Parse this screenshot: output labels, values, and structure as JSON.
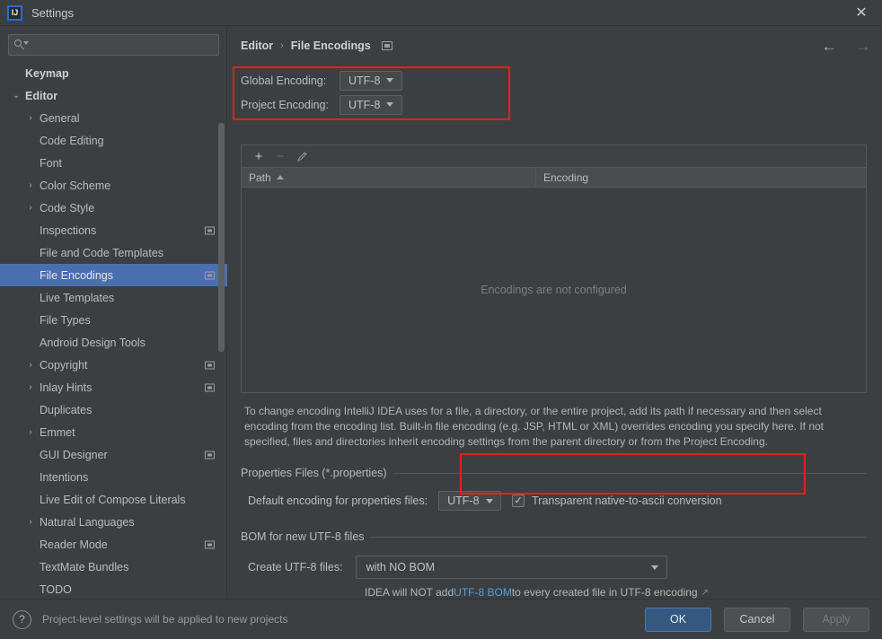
{
  "window": {
    "title": "Settings",
    "logo_text": "IJ",
    "close_icon": "✕"
  },
  "search": {
    "placeholder": "",
    "value": "",
    "icon": "search-icon"
  },
  "sidebar": {
    "items": [
      {
        "label": "Keymap",
        "level": 0,
        "arrow": "",
        "bold": true,
        "selected": false,
        "badge": false
      },
      {
        "label": "Editor",
        "level": 0,
        "arrow": "⌄",
        "bold": true,
        "selected": false,
        "badge": false
      },
      {
        "label": "General",
        "level": 1,
        "arrow": "›",
        "bold": false,
        "selected": false,
        "badge": false
      },
      {
        "label": "Code Editing",
        "level": 1,
        "arrow": "",
        "bold": false,
        "selected": false,
        "badge": false
      },
      {
        "label": "Font",
        "level": 1,
        "arrow": "",
        "bold": false,
        "selected": false,
        "badge": false
      },
      {
        "label": "Color Scheme",
        "level": 1,
        "arrow": "›",
        "bold": false,
        "selected": false,
        "badge": false
      },
      {
        "label": "Code Style",
        "level": 1,
        "arrow": "›",
        "bold": false,
        "selected": false,
        "badge": false
      },
      {
        "label": "Inspections",
        "level": 1,
        "arrow": "",
        "bold": false,
        "selected": false,
        "badge": true
      },
      {
        "label": "File and Code Templates",
        "level": 1,
        "arrow": "",
        "bold": false,
        "selected": false,
        "badge": false
      },
      {
        "label": "File Encodings",
        "level": 1,
        "arrow": "",
        "bold": false,
        "selected": true,
        "badge": true
      },
      {
        "label": "Live Templates",
        "level": 1,
        "arrow": "",
        "bold": false,
        "selected": false,
        "badge": false
      },
      {
        "label": "File Types",
        "level": 1,
        "arrow": "",
        "bold": false,
        "selected": false,
        "badge": false
      },
      {
        "label": "Android Design Tools",
        "level": 1,
        "arrow": "",
        "bold": false,
        "selected": false,
        "badge": false
      },
      {
        "label": "Copyright",
        "level": 1,
        "arrow": "›",
        "bold": false,
        "selected": false,
        "badge": true
      },
      {
        "label": "Inlay Hints",
        "level": 1,
        "arrow": "›",
        "bold": false,
        "selected": false,
        "badge": true
      },
      {
        "label": "Duplicates",
        "level": 1,
        "arrow": "",
        "bold": false,
        "selected": false,
        "badge": false
      },
      {
        "label": "Emmet",
        "level": 1,
        "arrow": "›",
        "bold": false,
        "selected": false,
        "badge": false
      },
      {
        "label": "GUI Designer",
        "level": 1,
        "arrow": "",
        "bold": false,
        "selected": false,
        "badge": true
      },
      {
        "label": "Intentions",
        "level": 1,
        "arrow": "",
        "bold": false,
        "selected": false,
        "badge": false
      },
      {
        "label": "Live Edit of Compose Literals",
        "level": 1,
        "arrow": "",
        "bold": false,
        "selected": false,
        "badge": false
      },
      {
        "label": "Natural Languages",
        "level": 1,
        "arrow": "›",
        "bold": false,
        "selected": false,
        "badge": false
      },
      {
        "label": "Reader Mode",
        "level": 1,
        "arrow": "",
        "bold": false,
        "selected": false,
        "badge": true
      },
      {
        "label": "TextMate Bundles",
        "level": 1,
        "arrow": "",
        "bold": false,
        "selected": false,
        "badge": false
      },
      {
        "label": "TODO",
        "level": 1,
        "arrow": "",
        "bold": false,
        "selected": false,
        "badge": false
      }
    ]
  },
  "breadcrumb": {
    "parent": "Editor",
    "separator": "›",
    "current": "File Encodings"
  },
  "nav": {
    "back_icon": "←",
    "forward_icon": "→"
  },
  "encodings": {
    "global_label": "Global Encoding:",
    "global_value": "UTF-8",
    "project_label": "Project Encoding:",
    "project_value": "UTF-8"
  },
  "table": {
    "toolbar": {
      "add_icon": "+",
      "remove_icon": "−",
      "edit_icon": "edit-pencil-icon"
    },
    "columns": [
      "Path",
      "Encoding"
    ],
    "sort_column": "Path",
    "sort_direction": "ascending",
    "rows": [],
    "empty_message": "Encodings are not configured"
  },
  "description": "To change encoding IntelliJ IDEA uses for a file, a directory, or the entire project, add its path if necessary and then select encoding from the encoding list. Built-in file encoding (e.g. JSP, HTML or XML) overrides encoding you specify here. If not specified, files and directories inherit encoding settings from the parent directory or from the Project Encoding.",
  "properties_section": {
    "title": "Properties Files (*.properties)",
    "default_encoding_label": "Default encoding for properties files:",
    "default_encoding_value": "UTF-8",
    "checkbox_label": "Transparent native-to-ascii conversion",
    "checkbox_checked": true,
    "checkbox_mark": "✓"
  },
  "bom_section": {
    "title": "BOM for new UTF-8 files",
    "create_label": "Create UTF-8 files:",
    "create_value": "with NO BOM",
    "note_prefix": "IDEA will NOT add ",
    "note_link": "UTF-8 BOM",
    "note_suffix": " to every created file in UTF-8 encoding",
    "external_link_icon": "↗"
  },
  "footer": {
    "help_icon": "?",
    "note": "Project-level settings will be applied to new projects",
    "ok_label": "OK",
    "cancel_label": "Cancel",
    "apply_label": "Apply"
  },
  "colors": {
    "accent_selection": "#4b6eaf",
    "primary_button": "#365880",
    "highlight_box": "#ee1c1c",
    "link": "#5a9bd5",
    "window_bg": "#3c3f41"
  }
}
